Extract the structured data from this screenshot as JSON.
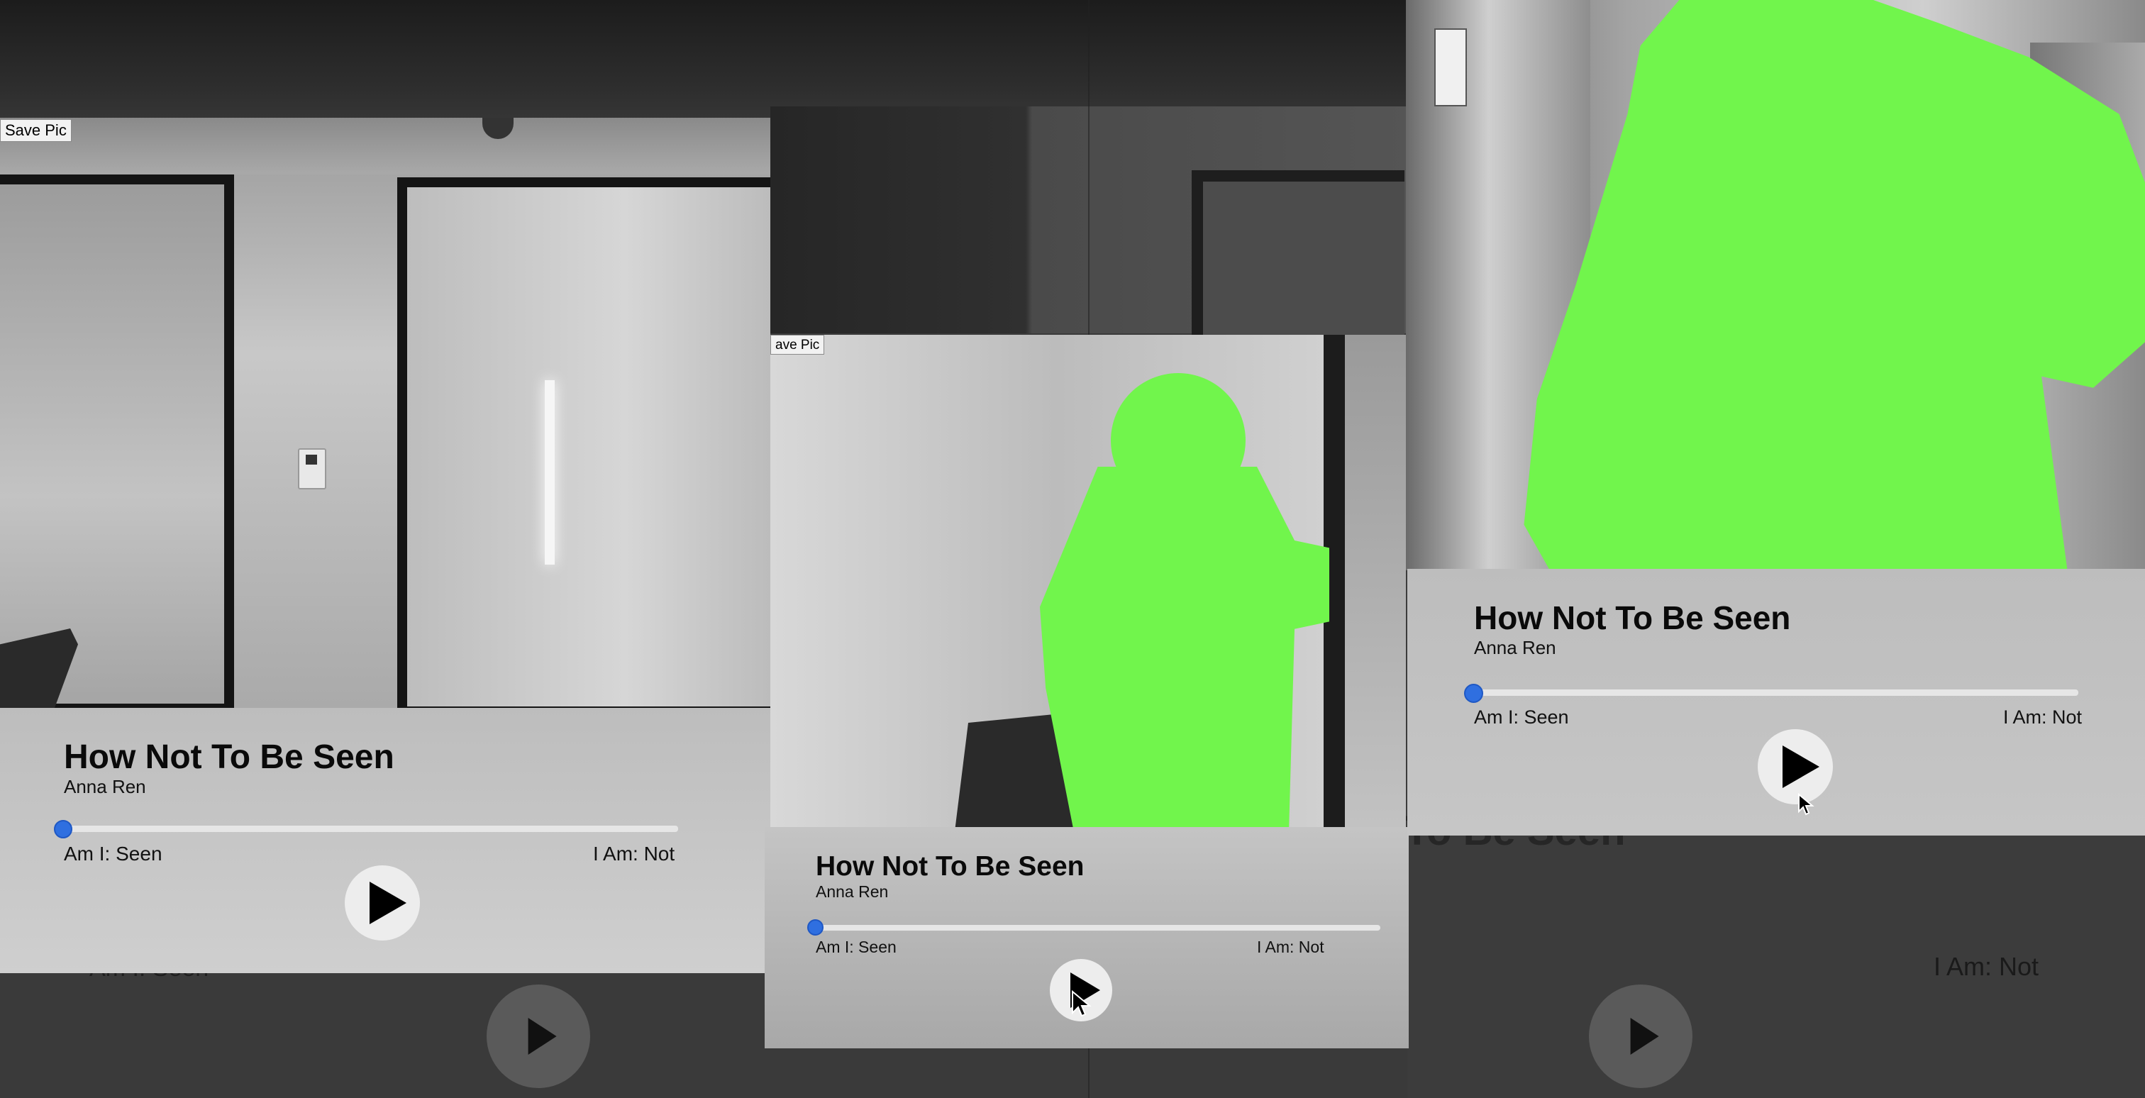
{
  "players": [
    {
      "save_label": "Save Pic",
      "title": "How Not To Be Seen",
      "artist": "Anna Ren",
      "left_label": "Am I: Seen",
      "right_label": "I Am: Not",
      "progress": 0
    },
    {
      "save_label": "ave Pic",
      "title": "How Not To Be Seen",
      "artist": "Anna Ren",
      "left_label": "Am I: Seen",
      "right_label": "I Am: Not",
      "progress": 0
    },
    {
      "title": "How Not To Be Seen",
      "artist": "Anna Ren",
      "left_label": "Am I: Seen",
      "right_label": "I Am: Not",
      "progress": 0
    }
  ],
  "background": {
    "title_fragment": "To Be Seen",
    "left_label_fragment": "Am I: Seen",
    "right_label": "I Am: Not"
  },
  "colors": {
    "silhouette": "#71f54c",
    "slider_thumb": "#2f6fe0",
    "panel": "#c8c8c8"
  },
  "icons": [
    "play-icon",
    "mouse-cursor-icon"
  ]
}
